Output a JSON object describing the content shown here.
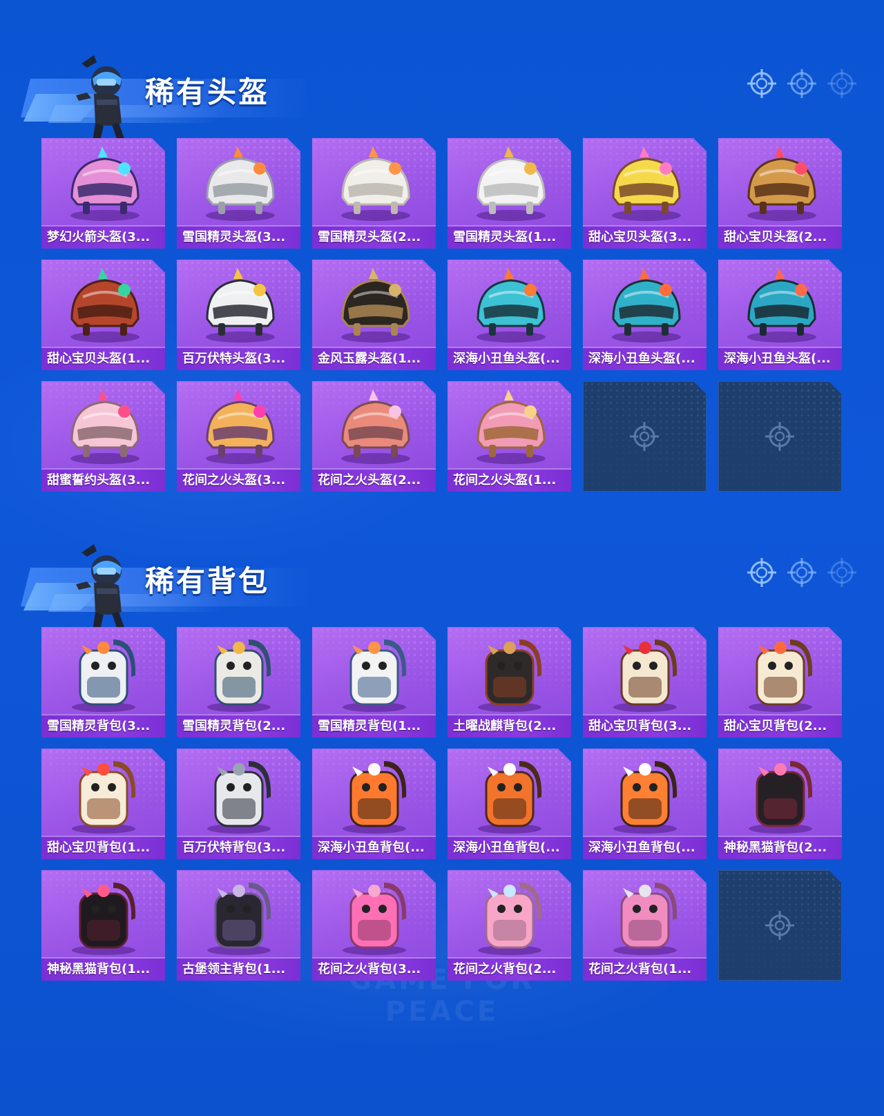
{
  "watermark": "GAME FOR PEACE",
  "sections": [
    {
      "title": "稀有头盔",
      "items": [
        {
          "name": "梦幻火箭头盔(3...",
          "kind": "helmet",
          "palette": [
            "#e58fd6",
            "#3a2b6e",
            "#4fe3ff"
          ]
        },
        {
          "name": "雪国精灵头盔(3...",
          "kind": "helmet",
          "palette": [
            "#e9e9ec",
            "#9aa0a8",
            "#ff8a3d"
          ]
        },
        {
          "name": "雪国精灵头盔(2...",
          "kind": "helmet",
          "palette": [
            "#f1efea",
            "#bdb8b0",
            "#ff9447"
          ]
        },
        {
          "name": "雪国精灵头盔(1...",
          "kind": "helmet",
          "palette": [
            "#f3f3f3",
            "#bcbcbc",
            "#f0b84a"
          ]
        },
        {
          "name": "甜心宝贝头盔(3...",
          "kind": "helmet",
          "palette": [
            "#f6d94a",
            "#7b4a2a",
            "#ff7bc4"
          ]
        },
        {
          "name": "甜心宝贝头盔(2...",
          "kind": "helmet",
          "palette": [
            "#d49a4b",
            "#5a3218",
            "#ff4d6b"
          ]
        },
        {
          "name": "甜心宝贝头盔(1...",
          "kind": "helmet",
          "palette": [
            "#b5462c",
            "#4c2014",
            "#34d6a0"
          ]
        },
        {
          "name": "百万伏特头盔(3...",
          "kind": "helmet",
          "palette": [
            "#eef0f2",
            "#2a2d36",
            "#f5c443"
          ]
        },
        {
          "name": "金风玉露头盔(1...",
          "kind": "helmet",
          "palette": [
            "#2c2620",
            "#a98552",
            "#d8b46a"
          ]
        },
        {
          "name": "深海小丑鱼头盔(...",
          "kind": "helmet",
          "palette": [
            "#3cc2d4",
            "#1b3440",
            "#ff7a33"
          ]
        },
        {
          "name": "深海小丑鱼头盔(...",
          "kind": "helmet",
          "palette": [
            "#2fb1c9",
            "#1f2e36",
            "#ff6c3a"
          ]
        },
        {
          "name": "深海小丑鱼头盔(...",
          "kind": "helmet",
          "palette": [
            "#2ba7c4",
            "#1a2a33",
            "#ff6a4a"
          ]
        },
        {
          "name": "甜蜜誓约头盔(3...",
          "kind": "helmet",
          "palette": [
            "#f7c6d6",
            "#8c6b72",
            "#ff4f8b"
          ]
        },
        {
          "name": "花间之火头盔(3...",
          "kind": "helmet",
          "palette": [
            "#f3b25a",
            "#6b3f6e",
            "#ff3fb0"
          ]
        },
        {
          "name": "花间之火头盔(2...",
          "kind": "helmet",
          "palette": [
            "#e98a7a",
            "#7c4a54",
            "#f7c4e6"
          ]
        },
        {
          "name": "花间之火头盔(1...",
          "kind": "helmet",
          "palette": [
            "#f29bb6",
            "#a0683a",
            "#f9d18a"
          ]
        },
        {
          "name": "",
          "kind": "empty"
        },
        {
          "name": "",
          "kind": "empty"
        }
      ]
    },
    {
      "title": "稀有背包",
      "items": [
        {
          "name": "雪国精灵背包(3...",
          "kind": "backpack",
          "palette": [
            "#eef0f3",
            "#2c4f7a",
            "#ff8a3d"
          ]
        },
        {
          "name": "雪国精灵背包(2...",
          "kind": "backpack",
          "palette": [
            "#eceae4",
            "#2f5070",
            "#f0b84a"
          ]
        },
        {
          "name": "雪国精灵背包(1...",
          "kind": "backpack",
          "palette": [
            "#f3f3f3",
            "#3a5a8a",
            "#ff9447"
          ]
        },
        {
          "name": "土曜战麒背包(2...",
          "kind": "backpack",
          "palette": [
            "#2e2a2a",
            "#8c3e22",
            "#d9a257"
          ]
        },
        {
          "name": "甜心宝贝背包(3...",
          "kind": "backpack",
          "palette": [
            "#f4e8d0",
            "#6b3b22",
            "#e8303a"
          ]
        },
        {
          "name": "甜心宝贝背包(2...",
          "kind": "backpack",
          "palette": [
            "#f7ead2",
            "#6e3c21",
            "#ff6a3d"
          ]
        },
        {
          "name": "甜心宝贝背包(1...",
          "kind": "backpack",
          "palette": [
            "#f6ecd8",
            "#8a4a26",
            "#ff4d3d"
          ]
        },
        {
          "name": "百万伏特背包(3...",
          "kind": "backpack",
          "palette": [
            "#e6e8ec",
            "#2c2f38",
            "#9aa4b0"
          ]
        },
        {
          "name": "深海小丑鱼背包(...",
          "kind": "backpack",
          "palette": [
            "#ff7a2e",
            "#3b2418",
            "#ffffff"
          ]
        },
        {
          "name": "深海小丑鱼背包(...",
          "kind": "backpack",
          "palette": [
            "#f2732b",
            "#4a2a1a",
            "#ffffff"
          ]
        },
        {
          "name": "深海小丑鱼背包(...",
          "kind": "backpack",
          "palette": [
            "#ff7f33",
            "#3b2418",
            "#ffffff"
          ]
        },
        {
          "name": "神秘黑猫背包(2...",
          "kind": "backpack",
          "palette": [
            "#262026",
            "#7a2838",
            "#ff7ab0"
          ]
        },
        {
          "name": "神秘黑猫背包(1...",
          "kind": "backpack",
          "palette": [
            "#1f1a20",
            "#5a2030",
            "#ff5a8a"
          ]
        },
        {
          "name": "古堡领主背包(1...",
          "kind": "backpack",
          "palette": [
            "#2a2732",
            "#6a5a8a",
            "#c8b6e6"
          ]
        },
        {
          "name": "花间之火背包(3...",
          "kind": "backpack",
          "palette": [
            "#ff6fb5",
            "#8a3a6a",
            "#f7a8d0"
          ]
        },
        {
          "name": "花间之火背包(2...",
          "kind": "backpack",
          "palette": [
            "#f7a6c8",
            "#a06a8a",
            "#c9e7ff"
          ]
        },
        {
          "name": "花间之火背包(1...",
          "kind": "backpack",
          "palette": [
            "#f08cc0",
            "#8c4a7a",
            "#e6e6ee"
          ]
        },
        {
          "name": "",
          "kind": "empty"
        }
      ]
    }
  ]
}
